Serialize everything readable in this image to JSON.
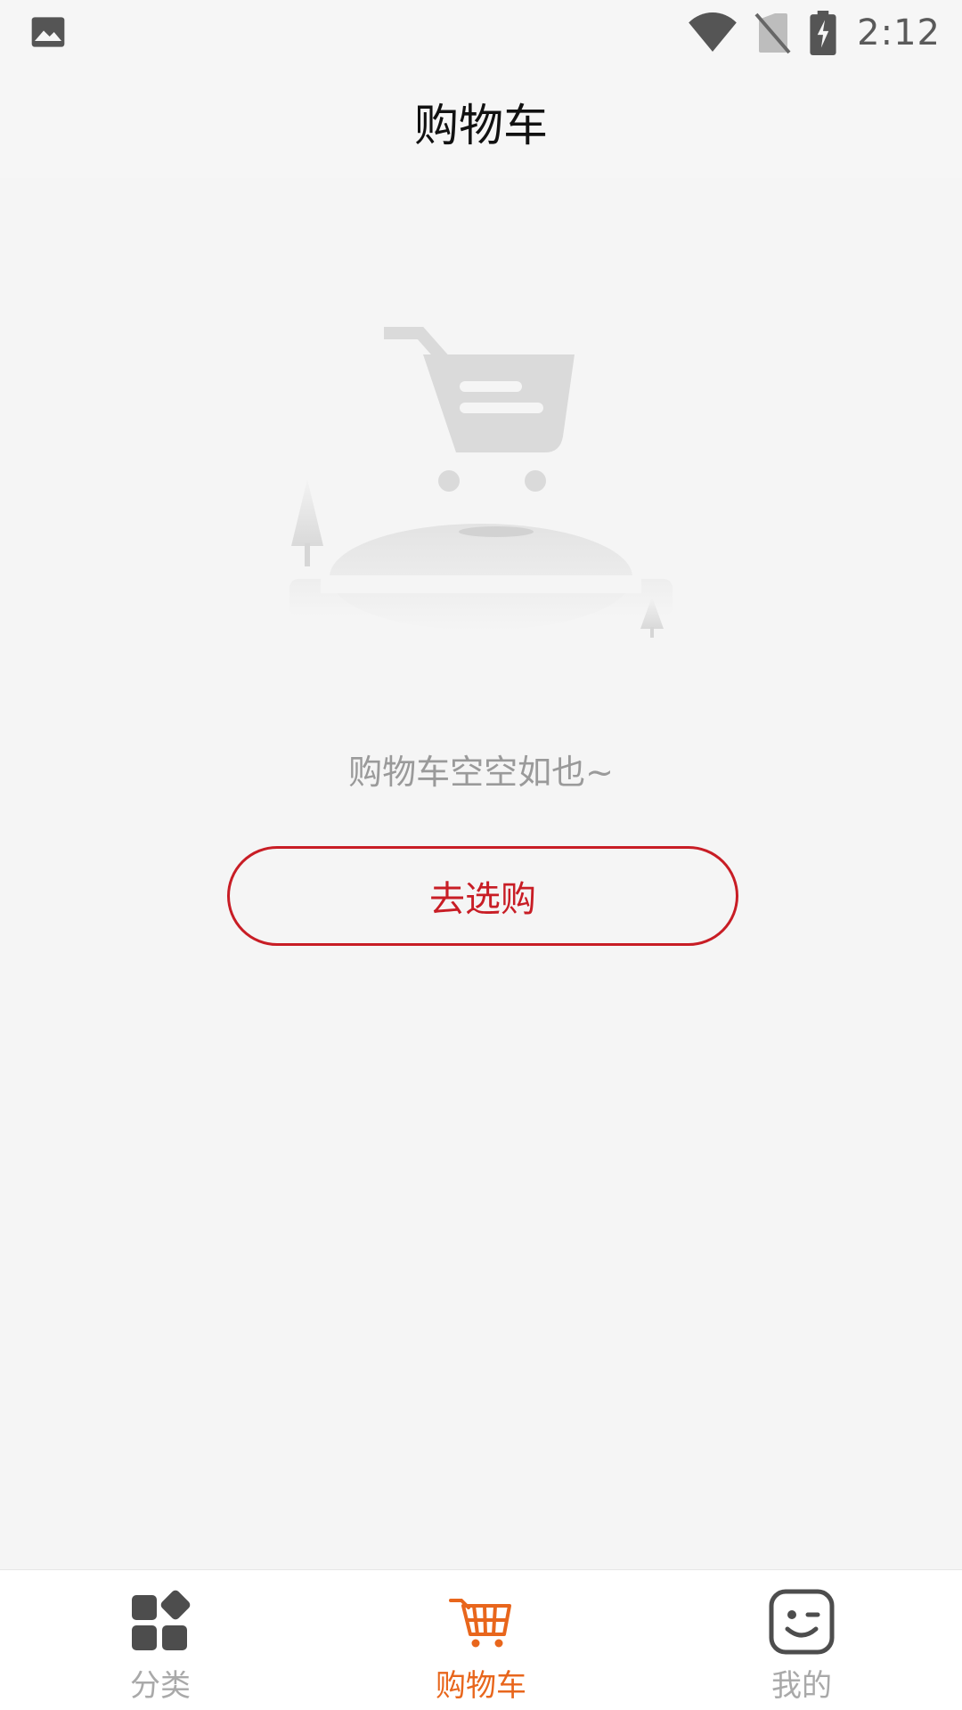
{
  "status_bar": {
    "time": "2:12",
    "icons": [
      "image-icon",
      "wifi-icon",
      "no-sim-icon",
      "battery-charging-icon"
    ]
  },
  "header": {
    "title": "购物车"
  },
  "empty_state": {
    "message": "购物车空空如也~",
    "button_label": "去选购",
    "illustration_icon": "empty-cart-illustration"
  },
  "bottom_nav": {
    "items": [
      {
        "label": "分类",
        "icon": "category-grid-icon",
        "active": false
      },
      {
        "label": "购物车",
        "icon": "shopping-cart-icon",
        "active": true
      },
      {
        "label": "我的",
        "icon": "smile-face-icon",
        "active": false
      }
    ]
  },
  "colors": {
    "accent_red": "#c81d25",
    "active_orange": "#e8661c",
    "inactive_gray": "#a9a9a9",
    "background": "#f5f5f5"
  }
}
